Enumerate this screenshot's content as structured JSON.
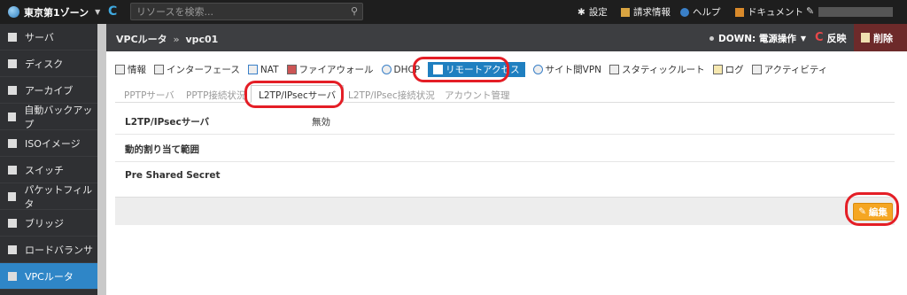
{
  "topbar": {
    "zone_label": "東京第1ゾーン",
    "search_placeholder": "リソースを検索...",
    "settings_label": "設定",
    "billing_label": "請求情報",
    "help_label": "ヘルプ",
    "docs_label": "ドキュメント"
  },
  "sidebar": {
    "items": [
      {
        "label": "サーバ",
        "icon": "server-icon"
      },
      {
        "label": "ディスク",
        "icon": "disk-icon"
      },
      {
        "label": "アーカイブ",
        "icon": "archive-icon"
      },
      {
        "label": "自動バックアップ",
        "icon": "backup-icon"
      },
      {
        "label": "ISOイメージ",
        "icon": "disc-icon"
      },
      {
        "label": "スイッチ",
        "icon": "switch-icon"
      },
      {
        "label": "パケットフィルタ",
        "icon": "filter-icon"
      },
      {
        "label": "ブリッジ",
        "icon": "bridge-icon"
      },
      {
        "label": "ロードバランサ",
        "icon": "loadbalancer-icon"
      },
      {
        "label": "VPCルータ",
        "icon": "cloud-icon"
      }
    ]
  },
  "header": {
    "crumb_parent": "VPCルータ",
    "crumb_sep": "»",
    "crumb_current": "vpc01",
    "status_label": "DOWN: 電源操作",
    "reflect_label": "反映",
    "delete_label": "削除"
  },
  "tabs": [
    {
      "label": "情報"
    },
    {
      "label": "インターフェース"
    },
    {
      "label": "NAT"
    },
    {
      "label": "ファイアウォール"
    },
    {
      "label": "DHCP"
    },
    {
      "label": "リモートアクセス"
    },
    {
      "label": "サイト間VPN"
    },
    {
      "label": "スタティックルート"
    },
    {
      "label": "ログ"
    },
    {
      "label": "アクティビティ"
    }
  ],
  "subtabs": [
    {
      "label": "PPTPサーバ"
    },
    {
      "label": "PPTP接続状況"
    },
    {
      "label": "L2TP/IPsecサーバ"
    },
    {
      "label": "L2TP/IPsec接続状況"
    },
    {
      "label": "アカウント管理"
    }
  ],
  "fields": [
    {
      "label": "L2TP/IPsecサーバ",
      "value": "無効"
    },
    {
      "label": "動的割り当て範囲",
      "value": ""
    },
    {
      "label": "Pre Shared Secret",
      "value": ""
    }
  ],
  "edit_label": "編集",
  "colors": {
    "accent": "#1f7fc0",
    "sidebar_active": "#2f86c7",
    "edit_button": "#f5a623",
    "annotation": "#e41e26"
  }
}
